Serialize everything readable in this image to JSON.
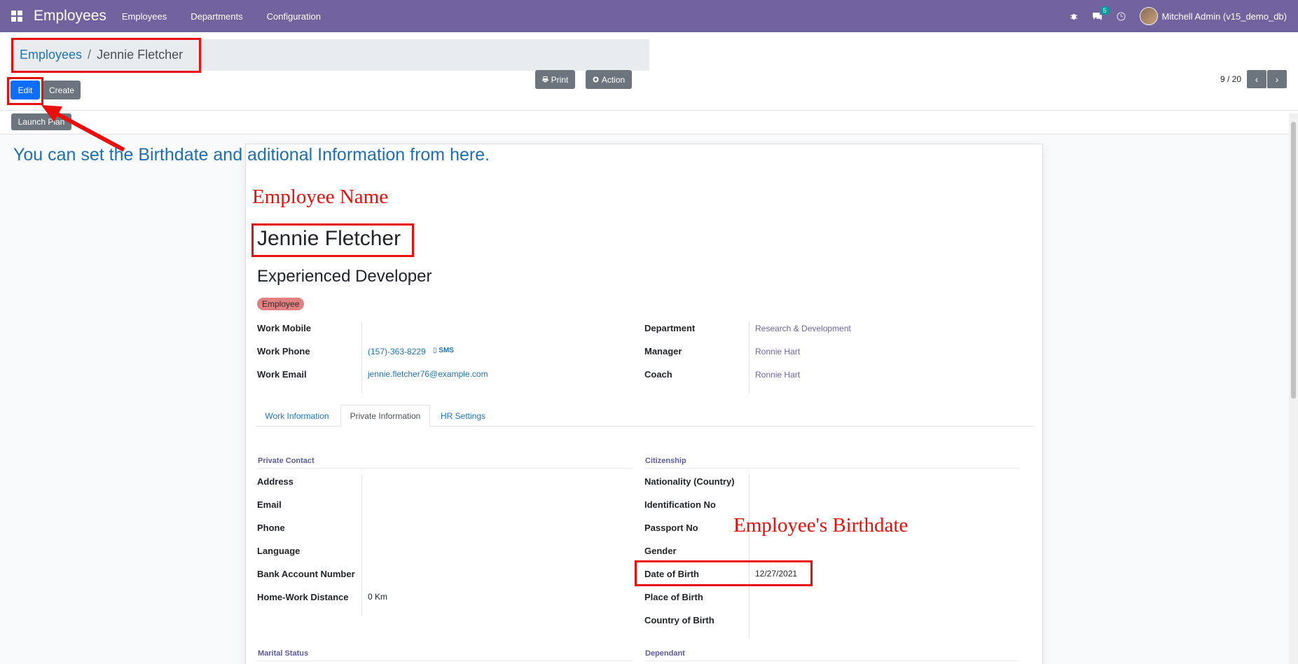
{
  "navbar": {
    "app_title": "Employees",
    "menu": [
      "Employees",
      "Departments",
      "Configuration"
    ],
    "chat_badge": "5",
    "user": "Mitchell Admin (v15_demo_db)"
  },
  "breadcrumb": {
    "parent": "Employees",
    "separator": "/",
    "current": "Jennie Fletcher"
  },
  "buttons": {
    "edit": "Edit",
    "create": "Create",
    "print": "Print",
    "action": "Action",
    "launch_plan": "Launch Plan"
  },
  "pager": {
    "value": "9 / 20"
  },
  "employee": {
    "name": "Jennie Fletcher",
    "job_title": "Experienced Developer",
    "tag": "Employee"
  },
  "contact_fields": [
    {
      "label": "Work Mobile",
      "value": ""
    },
    {
      "label": "Work Phone",
      "value": "(157)-363-8229"
    },
    {
      "label": "Work Email",
      "value": "jennie.fletcher76@example.com"
    }
  ],
  "sms_label": "SMS",
  "org_fields": [
    {
      "label": "Department",
      "value": "Research & Development"
    },
    {
      "label": "Manager",
      "value": "Ronnie Hart"
    },
    {
      "label": "Coach",
      "value": "Ronnie Hart"
    }
  ],
  "tabs": [
    "Work Information",
    "Private Information",
    "HR Settings"
  ],
  "active_tab": "Private Information",
  "private_contact": {
    "title": "Private Contact",
    "fields": [
      {
        "label": "Address",
        "value": ""
      },
      {
        "label": "Email",
        "value": ""
      },
      {
        "label": "Phone",
        "value": ""
      },
      {
        "label": "Language",
        "value": ""
      },
      {
        "label": "Bank Account Number",
        "value": ""
      },
      {
        "label": "Home-Work Distance",
        "value": "0  Km"
      }
    ]
  },
  "citizenship": {
    "title": "Citizenship",
    "fields": [
      {
        "label": "Nationality (Country)",
        "value": ""
      },
      {
        "label": "Identification No",
        "value": ""
      },
      {
        "label": "Passport No",
        "value": ""
      },
      {
        "label": "Gender",
        "value": ""
      },
      {
        "label": "Date of Birth",
        "value": "12/27/2021"
      },
      {
        "label": "Place of Birth",
        "value": ""
      },
      {
        "label": "Country of Birth",
        "value": ""
      }
    ]
  },
  "section_titles": {
    "marital": "Marital Status",
    "dependant": "Dependant"
  },
  "annotations": {
    "instruction": "You can set the Birthdate and aditional Information from here.",
    "employee_name": "Employee Name",
    "birthdate": "Employee's Birthdate"
  },
  "colors": {
    "navbar": "#71639e",
    "annotation_red": "#e8100d",
    "annotation_blue": "#1f6fb5",
    "tag": "#e28080",
    "primary": "#0d6efd"
  }
}
